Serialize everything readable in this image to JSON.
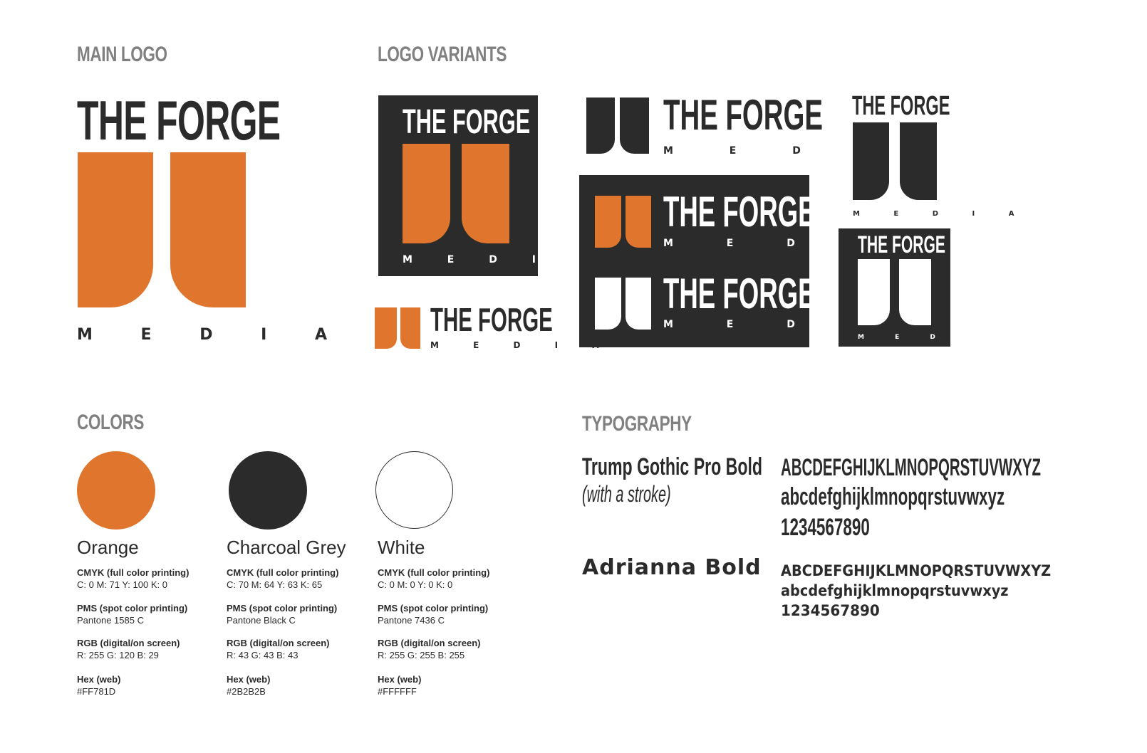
{
  "sections": {
    "main_logo": "MAIN LOGO",
    "logo_variants": "LOGO VARIANTS",
    "colors": "COLORS",
    "typography": "TYPOGRAPHY"
  },
  "logo": {
    "wordmark": "THE FORGE",
    "subline": "M E D I A"
  },
  "brand_colors": {
    "orange": "#FF781D",
    "charcoal": "#2B2B2B",
    "white": "#FFFFFF",
    "logo_orange": "#E0762D"
  },
  "colors": [
    {
      "name": "Orange",
      "cmyk_label": "CMYK (full color printing)",
      "cmyk": "C: 0   M: 71   Y: 100   K: 0",
      "pms_label": "PMS (spot color printing)",
      "pms": "Pantone 1585 C",
      "rgb_label": "RGB (digital/on screen)",
      "rgb": "R: 255   G: 120   B: 29",
      "hex_label": "Hex (web)",
      "hex": "#FF781D"
    },
    {
      "name": "Charcoal Grey",
      "cmyk_label": "CMYK (full color printing)",
      "cmyk": "C: 70   M: 64   Y: 63   K: 65",
      "pms_label": "PMS (spot color printing)",
      "pms": "Pantone Black C",
      "rgb_label": "RGB (digital/on screen)",
      "rgb": "R: 43   G: 43   B: 43",
      "hex_label": "Hex (web)",
      "hex": "#2B2B2B"
    },
    {
      "name": "White",
      "cmyk_label": "CMYK (full color printing)",
      "cmyk": "C: 0   M: 0   Y: 0   K: 0",
      "pms_label": "PMS (spot color printing)",
      "pms": "Pantone 7436 C",
      "rgb_label": "RGB (digital/on screen)",
      "rgb": "R: 255   G: 255   B: 255",
      "hex_label": "Hex (web)",
      "hex": "#FFFFFF"
    }
  ],
  "typography": [
    {
      "font_name": "Trump Gothic Pro Bold",
      "note": "(with a stroke)",
      "upper": "ABCDEFGHIJKLMNOPQRSTUVWXYZ",
      "lower": "abcdefghijklmnopqrstuvwxyz",
      "digits": "1234567890"
    },
    {
      "font_name": "Adrianna Bold",
      "upper": "ABCDEFGHIJKLMNOPQRSTUVWXYZ",
      "lower": "abcdefghijklmnopqrstuvwxyz",
      "digits": "1234567890"
    }
  ]
}
